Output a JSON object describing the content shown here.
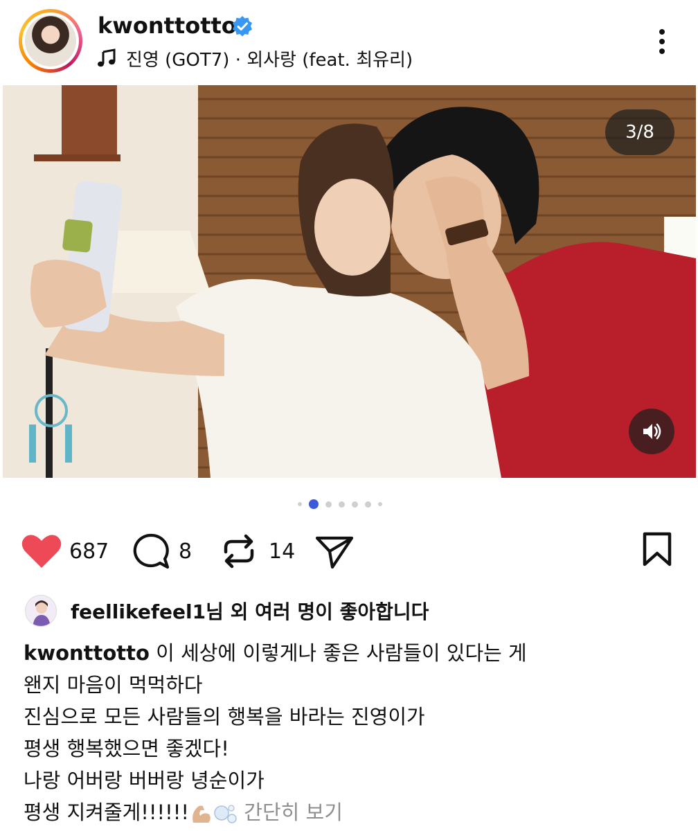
{
  "post": {
    "username": "kwonttotto",
    "verified": true,
    "music": "진영 (GOT7) · 외사랑 (feat. 최유리)",
    "icons": {
      "more": "more-vertical-icon",
      "music": "music-note-icon",
      "verified": "verified-badge-icon"
    }
  },
  "photo": {
    "counter": "3/8",
    "sound_icon": "speaker-icon"
  },
  "carousel": {
    "total": 8,
    "active_index": 1
  },
  "actions": {
    "likes": "687",
    "comments": "8",
    "reposts": "14",
    "liked": true,
    "colors": {
      "like": "#ed4956",
      "active_dot": "#3b5bdb"
    }
  },
  "likes_line": {
    "user": "feellikefeel1",
    "text": "님 외 여러 명이 좋아합니다"
  },
  "caption": {
    "username": "kwonttotto",
    "lines": [
      " 이 세상에 이렇게나 좋은 사람들이 있다는 게",
      "왠지 마음이 먹먹하다",
      "진심으로 모든 사람들의 행복을 바라는 진영이가",
      "평생 행복했으면 좋겠다!",
      "나랑 어버랑 버버랑 녕순이가",
      "평생 지켜줄게!!!!!!"
    ],
    "more": " 간단히 보기"
  }
}
